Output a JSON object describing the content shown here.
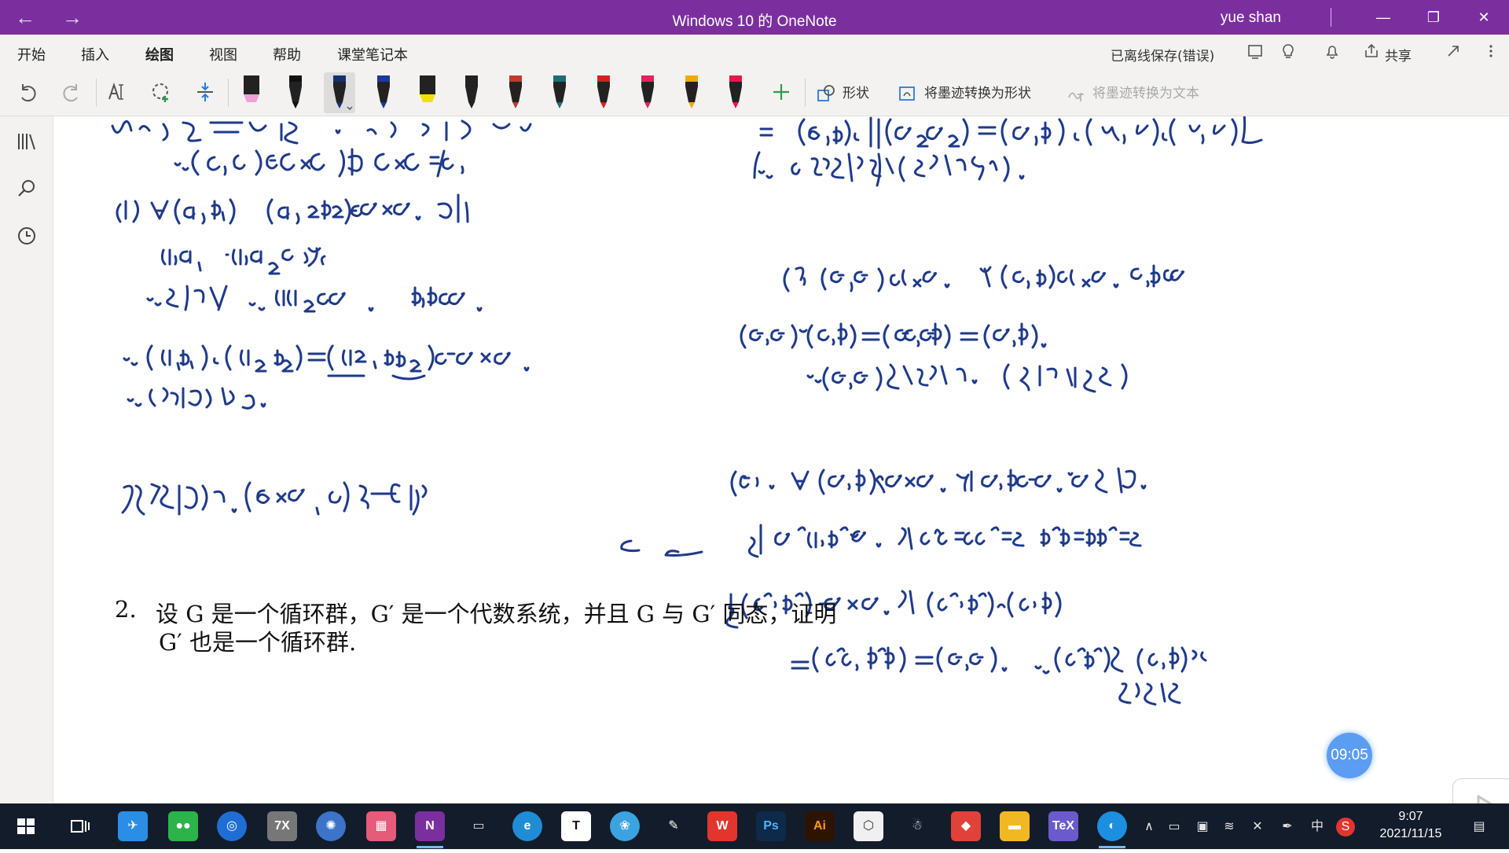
{
  "window": {
    "title": "Windows 10 的 OneNote",
    "user": "yue shan",
    "back_icon": "←",
    "forward_icon": "→",
    "minimize_icon": "—",
    "restore_icon": "❐",
    "close_icon": "✕"
  },
  "ribbon": {
    "tabs": [
      "开始",
      "插入",
      "绘图",
      "视图",
      "帮助",
      "课堂笔记本"
    ],
    "active_tab": "绘图",
    "save_status": "已离线保存(错误)",
    "share_label": "共享"
  },
  "toolbar": {
    "shapes_label": "形状",
    "ink_to_shape_label": "将墨迹转换为形状",
    "ink_to_text_label": "将墨迹转换为文本",
    "pens": [
      {
        "color": "#f0a0d8",
        "kind": "highlighter"
      },
      {
        "color": "#111111",
        "kind": "pen"
      },
      {
        "color": "#15306e",
        "kind": "pen",
        "selected": true
      },
      {
        "color": "#1a3a9a",
        "kind": "pen"
      },
      {
        "color": "#f5e100",
        "kind": "highlighter"
      },
      {
        "color": "#222222",
        "kind": "pencil"
      },
      {
        "color": "#c0392b",
        "kind": "pen"
      },
      {
        "color": "#1f6b7a",
        "kind": "pen"
      },
      {
        "color": "#d62020",
        "kind": "pen"
      },
      {
        "color": "#e0245e",
        "kind": "pen"
      },
      {
        "color": "#f2a900",
        "kind": "pen"
      },
      {
        "color": "#e8184a",
        "kind": "pen"
      }
    ],
    "accent": "#7b2f9e"
  },
  "problem": {
    "number": "2.",
    "line1": "设 G 是一个循环群，G′ 是一个代数系统，并且 G 与 G′ 同态，证明",
    "line2": "G′ 也是一个循环群."
  },
  "video_timer": "09:05",
  "taskbar": {
    "time": "9:07",
    "date": "2021/11/15",
    "ime": "中"
  }
}
